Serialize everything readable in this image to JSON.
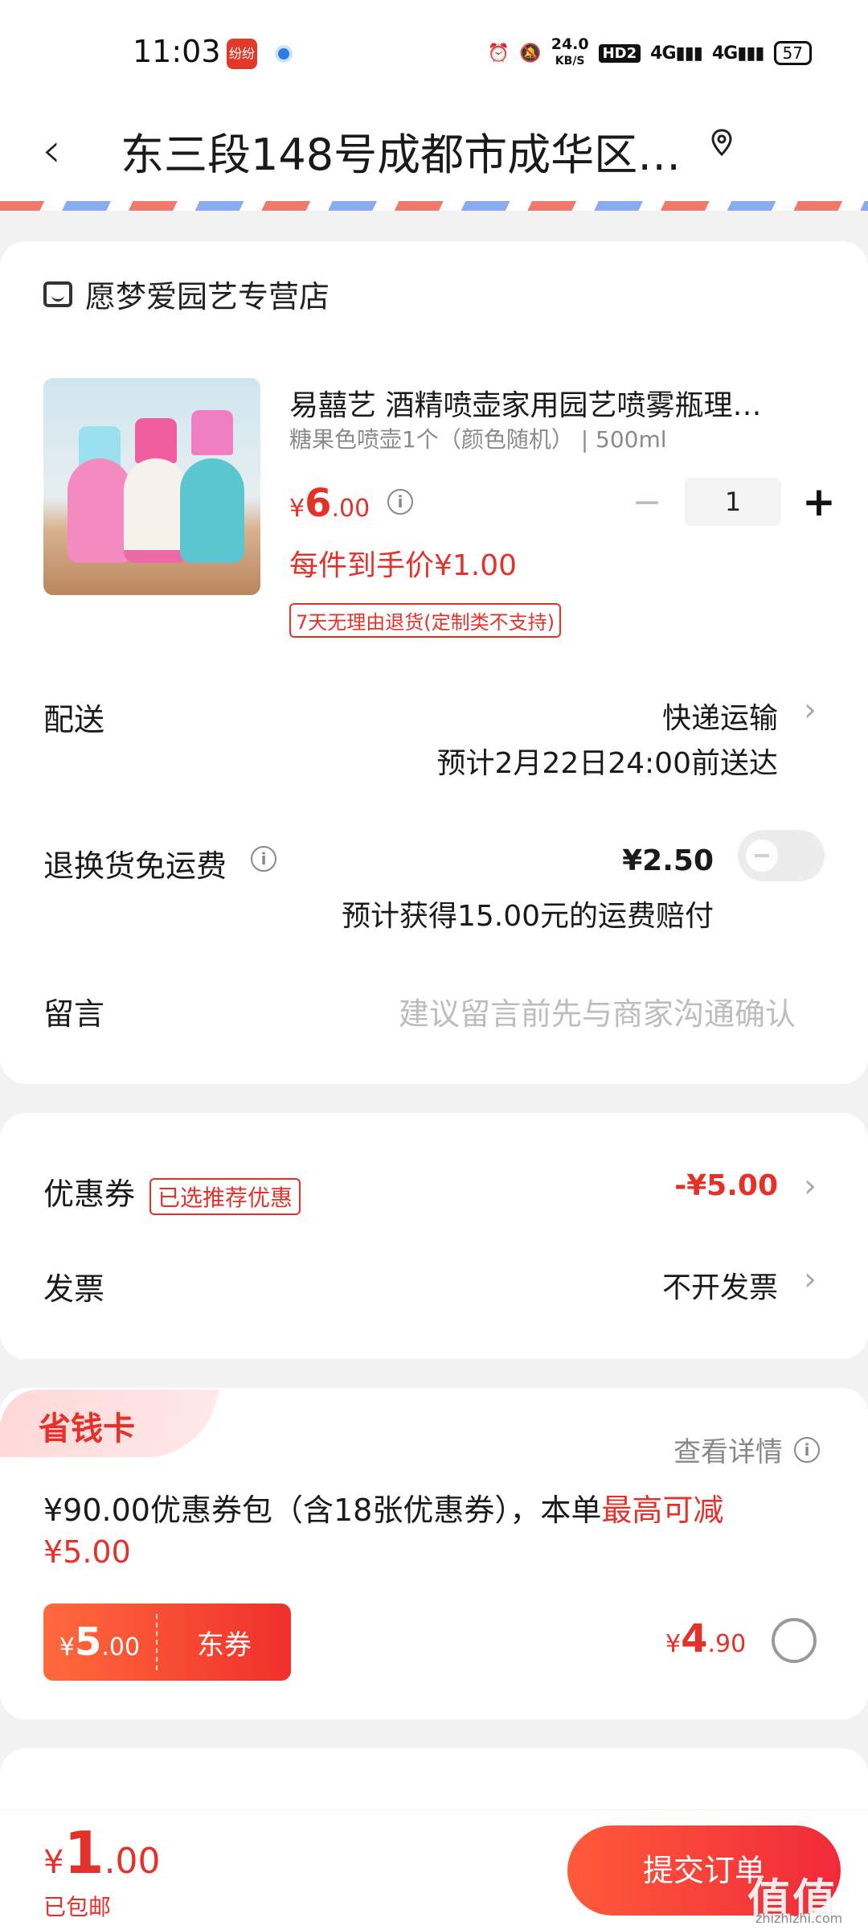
{
  "status_bar": {
    "time": "11:03",
    "app_icon_1_text": "纷纷",
    "net_speed_value": "24.0",
    "net_speed_unit": "KB/S",
    "hd": "HD2",
    "signal_1": "4G",
    "signal_2": "4G",
    "battery": "57"
  },
  "header": {
    "back_glyph": "‹",
    "address": "东三段148号成都市成华区…"
  },
  "store": {
    "name": "愿梦爱园艺专营店"
  },
  "product": {
    "title": "易囍艺 酒精喷壶家用园艺喷雾瓶理…",
    "spec": "糖果色喷壶1个（颜色随机） | 500ml",
    "price_symbol": "¥",
    "price_int": "6",
    "price_dec": ".00",
    "quantity": "1",
    "minus": "−",
    "plus": "+",
    "each_price": "每件到手价¥1.00",
    "return_policy": "7天无理由退货(定制类不支持)"
  },
  "delivery": {
    "label": "配送",
    "method": "快递运输",
    "eta": "预计2月22日24:00前送达"
  },
  "return_shipping": {
    "label": "退换货免运费",
    "price": "¥2.50",
    "note": "预计获得15.00元的运费赔付",
    "enabled": false
  },
  "message": {
    "label": "留言",
    "placeholder": "建议留言前先与商家沟通确认"
  },
  "coupon": {
    "label": "优惠券",
    "tag": "已选推荐优惠",
    "value": "-¥5.00"
  },
  "invoice": {
    "label": "发票",
    "value": "不开发票"
  },
  "saver_card": {
    "title": "省钱卡",
    "detail": "查看详情",
    "desc_prefix": "¥90.00优惠券包（含18张优惠券），本单",
    "desc_highlight": "最高可减",
    "desc_amount": "¥5.00",
    "voucher_symbol": "¥",
    "voucher_int": "5",
    "voucher_dec": ".00",
    "voucher_label": "东券",
    "price_symbol": "¥",
    "price_int": "4",
    "price_dec": ".90",
    "selected": false
  },
  "bottom": {
    "total_symbol": "¥",
    "total_int": "1",
    "total_dec": ".00",
    "shipping": "已包邮",
    "submit": "提交订单",
    "watermark": "值值值",
    "watermark_url": "zhizhizhi.com"
  },
  "colors": {
    "accent": "#e4322b",
    "submit_gradient": [
      "#ff5a3a",
      "#f02a3a"
    ]
  }
}
